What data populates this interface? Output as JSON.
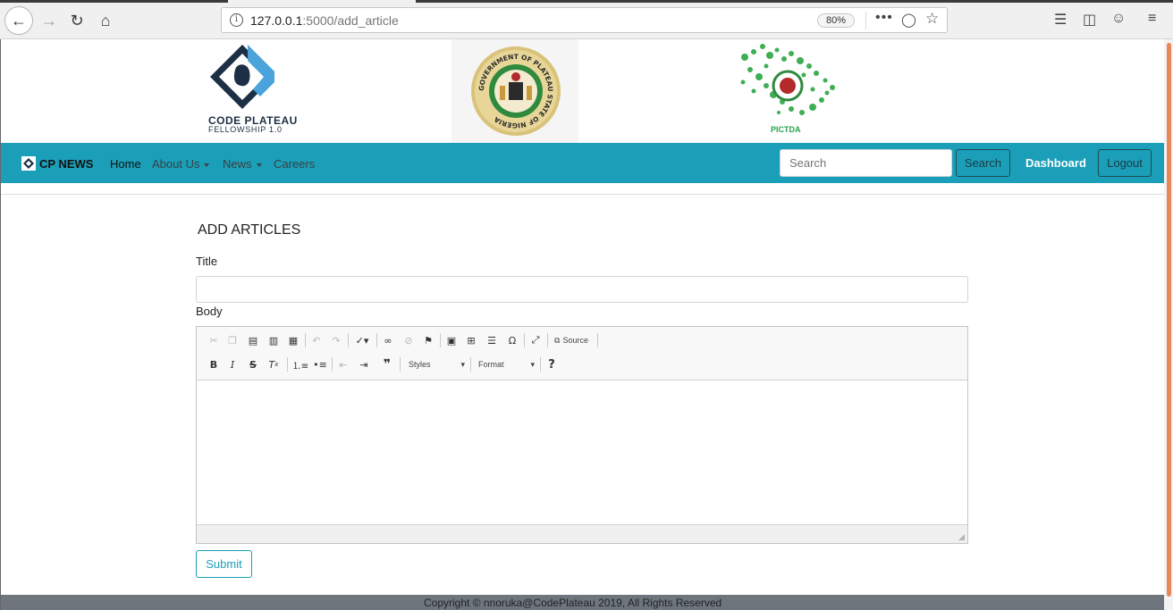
{
  "browser": {
    "url_host": "127.0.0.1",
    "url_path": ":5000/add_article",
    "zoom": "80%",
    "more": "•••"
  },
  "logos": {
    "code_plateau_line1": "CODE PLATEAU",
    "code_plateau_line2": "FELLOWSHIP 1.0",
    "seal_text": "GOVERNMENT OF PLATEAU STATE OF NIGERIA",
    "pictda_label": "PICTDA"
  },
  "navbar": {
    "brand": "CP NEWS",
    "home": "Home",
    "about": "About Us",
    "news": "News",
    "careers": "Careers",
    "search_placeholder": "Search",
    "search_button": "Search",
    "dashboard": "Dashboard",
    "logout": "Logout"
  },
  "form": {
    "heading": "ADD ARTICLES",
    "title_label": "Title",
    "title_value": "",
    "body_label": "Body",
    "submit": "Submit"
  },
  "editor": {
    "source_label": "Source",
    "styles_label": "Styles",
    "format_label": "Format"
  },
  "footer": {
    "copyright": "Copyright © nnoruka@CodePlateau 2019, All Rights Reserved"
  },
  "colors": {
    "navbar": "#1b9fb8",
    "footer": "#6e757c",
    "scroll_thumb": "#e8875a"
  }
}
